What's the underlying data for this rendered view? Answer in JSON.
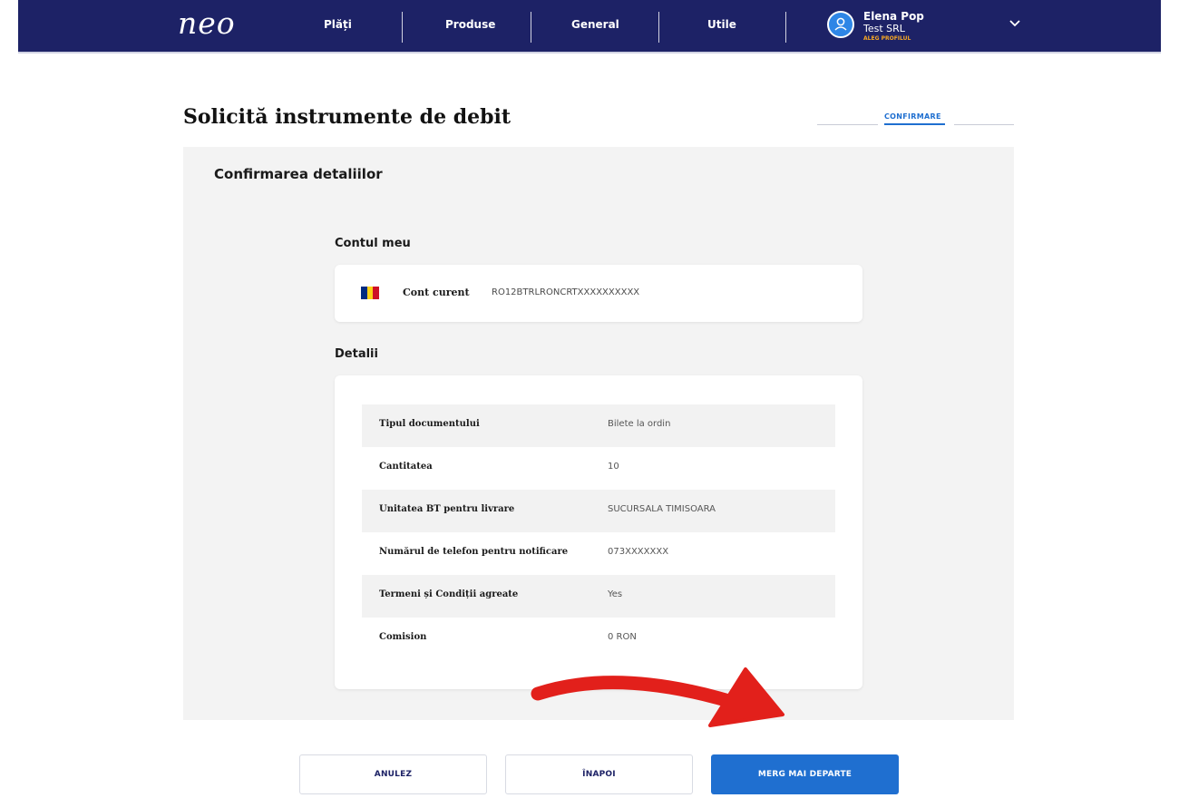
{
  "header": {
    "logo": "neo",
    "nav": [
      "Plăți",
      "Produse",
      "General",
      "Utile"
    ],
    "user": {
      "name": "Elena Pop",
      "company": "Test SRL",
      "profile_link": "ALEG PROFILUL"
    }
  },
  "page": {
    "title": "Solicită instrumente de debit",
    "step": "CONFIRMARE"
  },
  "panel": {
    "title": "Confirmarea detaliilor",
    "account_section": {
      "title": "Contul meu",
      "type": "Cont curent",
      "iban": "RO12BTRLRONCRTXXXXXXXXXX",
      "flag_colors": [
        "#002b7f",
        "#fcd116",
        "#ce1126"
      ]
    },
    "details_section": {
      "title": "Detalii",
      "rows": [
        {
          "label": "Tipul documentului",
          "value": "Bilete la ordin"
        },
        {
          "label": "Cantitatea",
          "value": "10"
        },
        {
          "label": "Unitatea BT pentru livrare",
          "value": "SUCURSALA TIMISOARA"
        },
        {
          "label": "Numărul de telefon pentru notificare",
          "value": "073XXXXXXX"
        },
        {
          "label": "Termeni și Condiții agreate",
          "value": "Yes"
        },
        {
          "label": "Comision",
          "value": "0 RON"
        }
      ]
    }
  },
  "buttons": {
    "cancel": "ANULEZ",
    "back": "ÎNAPOI",
    "next": "MERG MAI DEPARTE"
  },
  "colors": {
    "nav_bg": "#1d2266",
    "accent": "#1f6fd0",
    "panel_bg": "#f3f3f3",
    "annotation_arrow": "#e2201b"
  }
}
